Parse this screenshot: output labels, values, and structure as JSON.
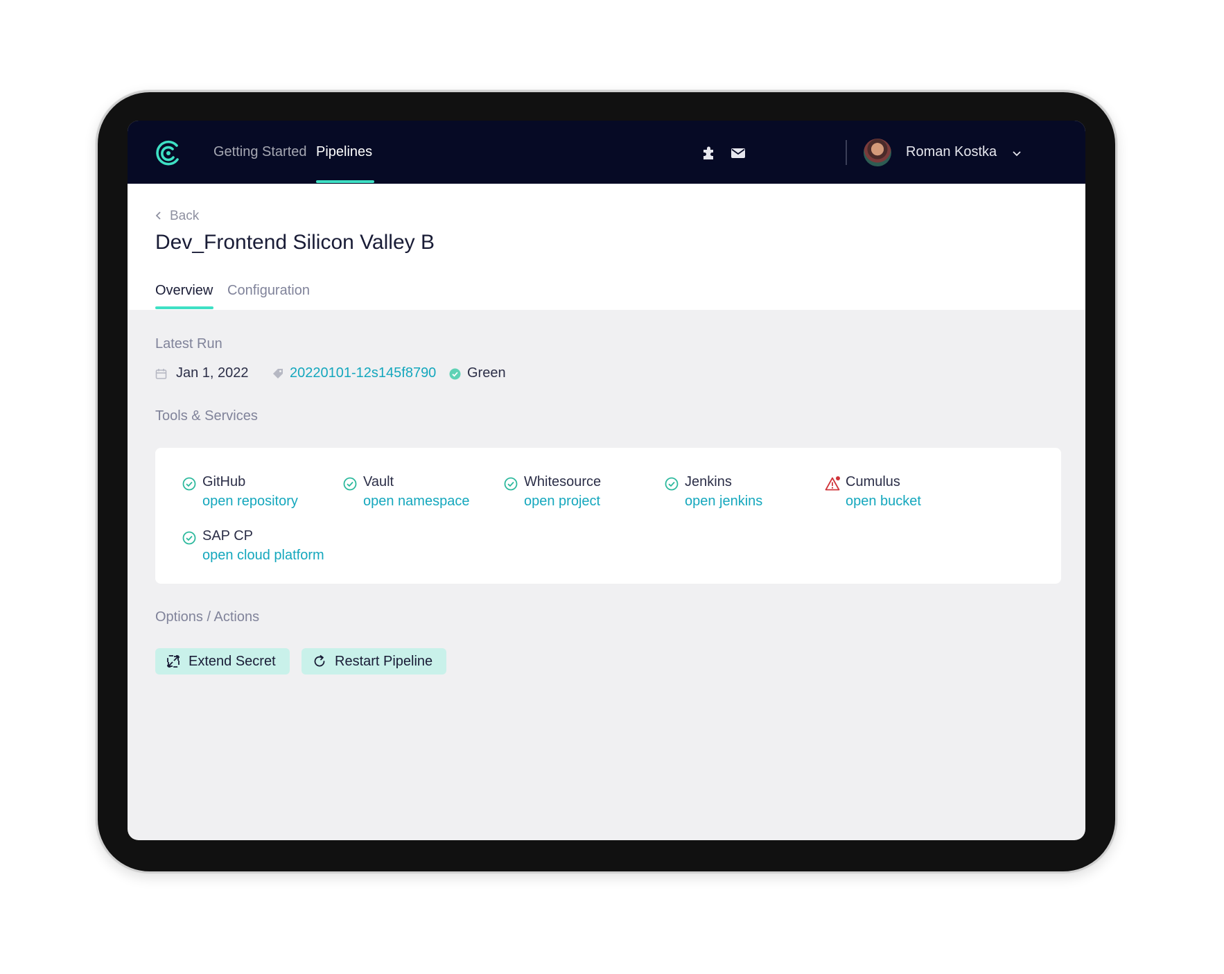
{
  "nav": {
    "links": [
      {
        "label": "Getting Started",
        "active": false
      },
      {
        "label": "Pipelines",
        "active": true
      }
    ],
    "icons": [
      "puzzle-icon",
      "mail-icon"
    ],
    "user": {
      "name": "Roman Kostka"
    }
  },
  "header": {
    "back_label": "Back",
    "title": "Dev_Frontend Silicon Valley B",
    "tabs": [
      {
        "label": "Overview",
        "active": true
      },
      {
        "label": "Configuration",
        "active": false
      }
    ]
  },
  "latest_run": {
    "section_title": "Latest Run",
    "date": "Jan 1, 2022",
    "run_id": "20220101-12s145f8790",
    "status": "Green"
  },
  "tools": {
    "section_title": "Tools & Services",
    "items": [
      {
        "name": "GitHub",
        "link": "open repository",
        "status": "ok"
      },
      {
        "name": "Vault",
        "link": "open namespace",
        "status": "ok"
      },
      {
        "name": "Whitesource",
        "link": "open project",
        "status": "ok"
      },
      {
        "name": "Jenkins",
        "link": "open jenkins",
        "status": "ok"
      },
      {
        "name": "Cumulus",
        "link": "open bucket",
        "status": "warning"
      },
      {
        "name": "SAP CP",
        "link": "open cloud platform",
        "status": "ok"
      }
    ]
  },
  "actions": {
    "section_title": "Options / Actions",
    "buttons": [
      {
        "label": "Extend Secret",
        "icon": "expand-icon"
      },
      {
        "label": "Restart Pipeline",
        "icon": "refresh-icon"
      }
    ]
  },
  "colors": {
    "nav_bg": "#060a25",
    "accent": "#3ee0c4",
    "link": "#14a7bd",
    "button_bg": "#c9f1ea",
    "warning": "#d0343a"
  }
}
